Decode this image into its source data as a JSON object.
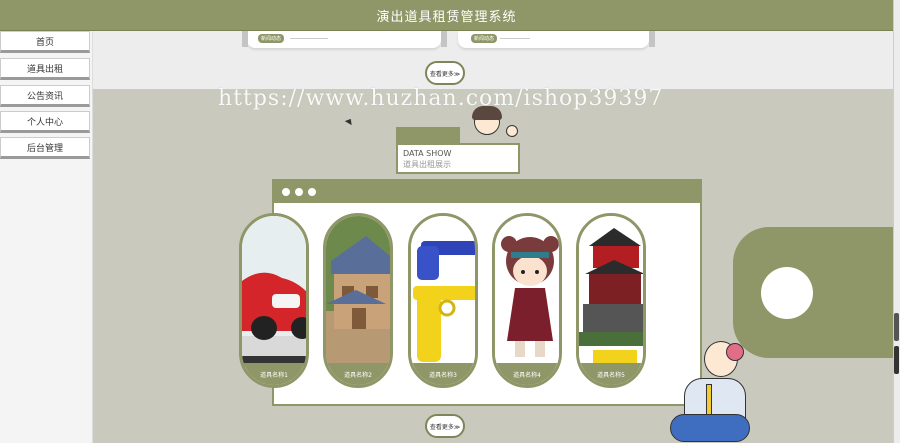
{
  "app": {
    "title": "演出道具租赁管理系统"
  },
  "sidebar": {
    "items": [
      {
        "label": "首页"
      },
      {
        "label": "道具出租"
      },
      {
        "label": "公告资讯"
      },
      {
        "label": "个人中心"
      },
      {
        "label": "后台管理"
      }
    ]
  },
  "top_cards": {
    "tags": [
      "新闻动态",
      "新闻动态"
    ]
  },
  "buttons": {
    "more_top": "查看更多≫",
    "more_bottom": "查看更多≫"
  },
  "watermark": "https://www.huzhan.com/ishop39397",
  "data_show": {
    "title": "DATA SHOW",
    "subtitle": "道具出租展示"
  },
  "products": [
    {
      "label": "道具名称1",
      "icon": "toy-car-image"
    },
    {
      "label": "道具名称2",
      "icon": "wooden-house-image"
    },
    {
      "label": "道具名称3",
      "icon": "toy-gun-image"
    },
    {
      "label": "道具名称4",
      "icon": "doll-image"
    },
    {
      "label": "道具名称5",
      "icon": "lego-temple-image"
    }
  ],
  "colors": {
    "accent": "#8f9667",
    "background": "#c9cabd"
  }
}
